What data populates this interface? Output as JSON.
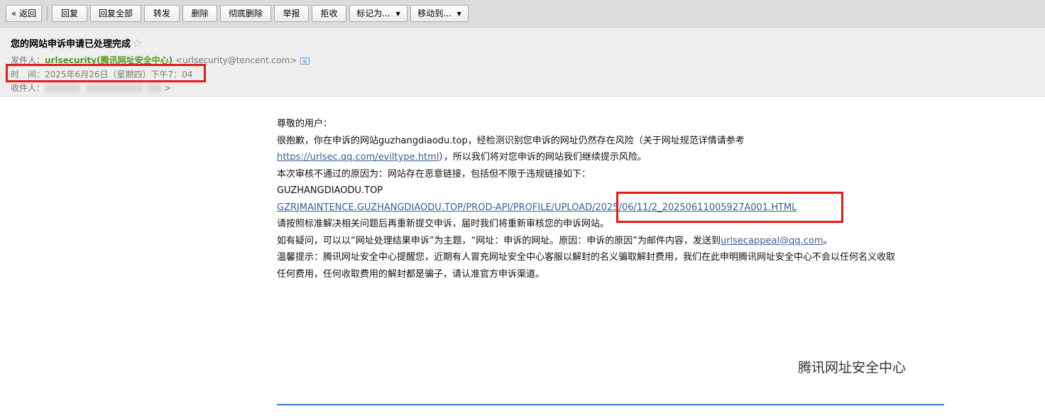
{
  "toolbar": {
    "back": "« 返回",
    "reply": "回复",
    "reply_all": "回复全部",
    "forward": "转发",
    "delete": "删除",
    "delete_permanently": "彻底删除",
    "report": "举报",
    "reject": "拒收",
    "mark_as": "标记为...",
    "move_to": "移动到..."
  },
  "email": {
    "subject": "您的网站申诉申请已处理完成",
    "from_label": "发件人：",
    "from_name": "urlsecurity(腾讯网址安全中心)",
    "from_address": "<urlsecurity@tencent.com>",
    "time_label": "时　间：",
    "time_value": "2025年6月26日（星期四）下午7：04",
    "to_label": "收件人：",
    "to_suffix": ">"
  },
  "body": {
    "greeting": "尊敬的用户：",
    "line1": "很抱歉，你在申诉的网站guzhangdiaodu.top，经检测识别您申诉的网址仍然存在风险（关于网址规范详情请参考",
    "link1": "https://urlsec.qq.com/eviltype.html",
    "line2_suffix": "），所以我们将对您申诉的网站我们继续提示风险。",
    "line3": "本次审核不通过的原因为：网站存在恶意链接，包括但不限于违规链接如下：",
    "line4": "GUZHANGDIAODU.TOP",
    "link2": "GZRJMAINTENCE.GUZHANGDIAODU.TOP/PROD-API/PROFILE/UPLOAD/2025/06/11/2_20250611005927A001.HTML",
    "line5": "请按照标准解决相关问题后再重新提交申诉，届时我们将重新审核您的申诉网站。",
    "line6_prefix": "如有疑问，可以以“网址处理结果申诉”为主题，“网址：申诉的网址。原因：申诉的原因”为邮件内容，发送到",
    "email_link": "urlsecappeal@qq.com",
    "line6_suffix": "。",
    "line7a": "温馨提示：腾讯网址安全中心提醒您，近期有人冒充网址安全中心客服以解封的名义骗取解封费用，我们在此申明腾讯网址安全中心不会以任何名义收取",
    "line7b": "任何费用，任何收取费用的解封都是骗子，请认准官方申诉渠道。",
    "signature": "腾讯网址安全中心"
  },
  "colors": {
    "highlight_box": "#e21b1b",
    "sender_name": "#4d9a1e",
    "link": "#3d5c98",
    "bottom_rule": "#3c7ad6"
  }
}
